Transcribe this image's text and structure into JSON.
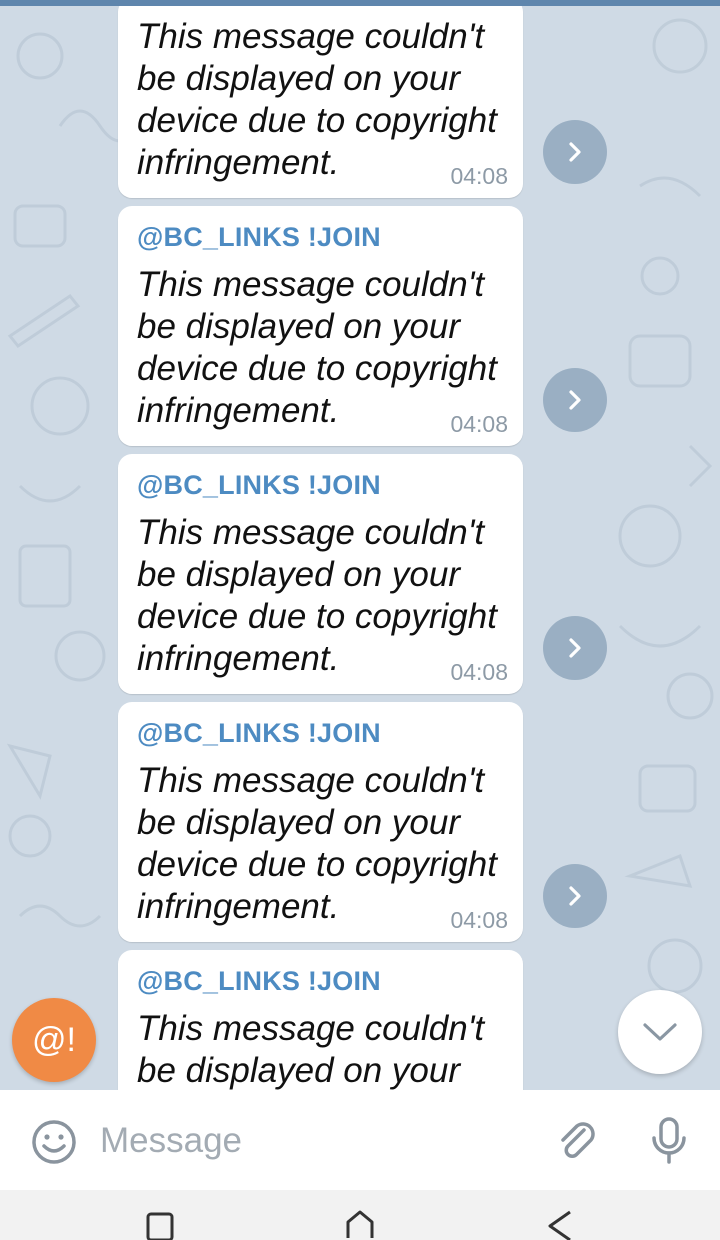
{
  "messages": [
    {
      "sender": "",
      "text": "This message couldn't\nbe displayed on your\ndevice due to copyright\ninfringement.",
      "time": "04:08"
    },
    {
      "sender": "@BC_LINKS !JOIN",
      "text": "This message couldn't\nbe displayed on your\ndevice due to copyright\ninfringement.",
      "time": "04:08"
    },
    {
      "sender": "@BC_LINKS !JOIN",
      "text": "This message couldn't\nbe displayed on your\ndevice due to copyright\ninfringement.",
      "time": "04:08"
    },
    {
      "sender": "@BC_LINKS !JOIN",
      "text": "This message couldn't\nbe displayed on your\ndevice due to copyright\ninfringement.",
      "time": "04:08"
    },
    {
      "sender": "@BC_LINKS !JOIN",
      "text": "This message couldn't\nbe displayed on your",
      "time": ""
    }
  ],
  "mention_button": {
    "label": "@!"
  },
  "composer": {
    "placeholder": "Message"
  },
  "icons": {
    "forward": "chevron-right-icon",
    "scroll_down": "chevron-down-icon",
    "emoji": "emoji-icon",
    "attach": "paperclip-icon",
    "mic": "microphone-icon",
    "nav": [
      "recents-icon",
      "home-icon",
      "back-icon"
    ]
  },
  "colors": {
    "accent": "#4d8bc2",
    "mention": "#f08a45",
    "chat_background": "#cfdae5"
  }
}
